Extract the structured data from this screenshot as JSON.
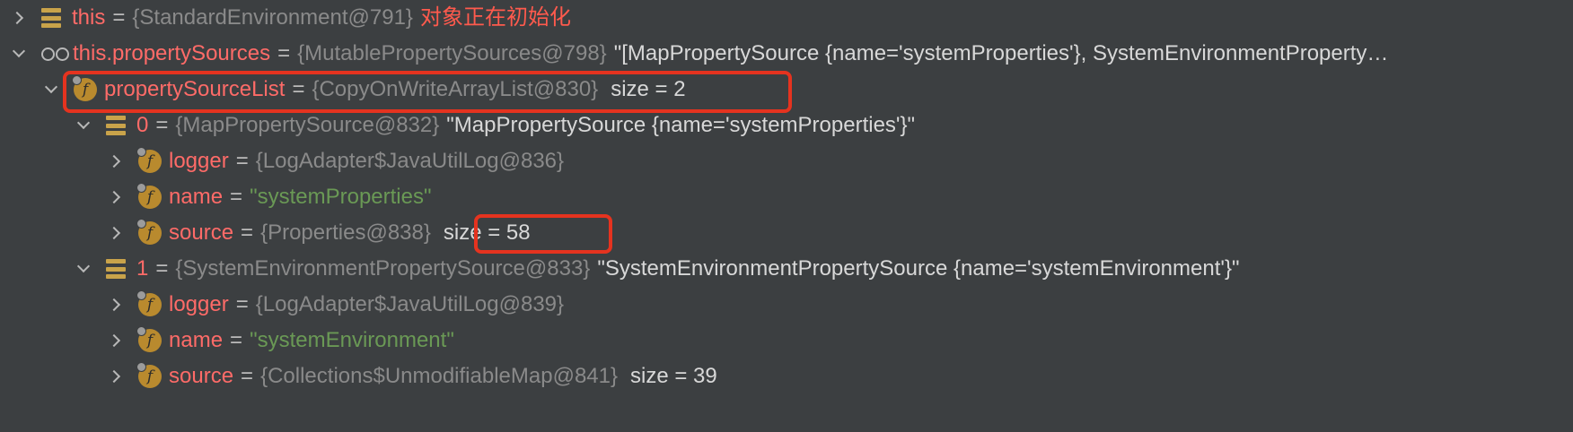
{
  "rows": [
    {
      "name": "this",
      "ref": "{StandardEnvironment@791}",
      "comment": "对象正在初始化"
    },
    {
      "name": "this.propertySources",
      "ref": "{MutablePropertySources@798}",
      "value": "\"[MapPropertySource {name='systemProperties'}, SystemEnvironmentProperty…"
    },
    {
      "name": "propertySourceList",
      "ref": "{CopyOnWriteArrayList@830}",
      "size": "size = 2"
    },
    {
      "name": "0",
      "ref": "{MapPropertySource@832}",
      "value": "\"MapPropertySource {name='systemProperties'}\""
    },
    {
      "name": "logger",
      "ref": "{LogAdapter$JavaUtilLog@836}"
    },
    {
      "name": "name",
      "value": "\"systemProperties\""
    },
    {
      "name": "source",
      "ref": "{Properties@838}",
      "size": "size = 58"
    },
    {
      "name": "1",
      "ref": "{SystemEnvironmentPropertySource@833}",
      "value": "\"SystemEnvironmentPropertySource {name='systemEnvironment'}\""
    },
    {
      "name": "logger",
      "ref": "{LogAdapter$JavaUtilLog@839}"
    },
    {
      "name": "name",
      "value": "\"systemEnvironment\""
    },
    {
      "name": "source",
      "ref": "{Collections$UnmodifiableMap@841}",
      "size": "size = 39"
    }
  ],
  "eq": "=",
  "icons": {
    "field": "f"
  }
}
